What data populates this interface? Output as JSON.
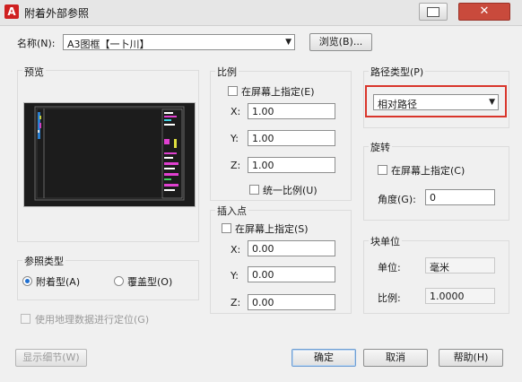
{
  "window": {
    "title": "附着外部参照",
    "close_glyph": "✕"
  },
  "name_row": {
    "label": "名称(N):",
    "value": "A3图框【一卜川】",
    "browse_label": "浏览(B)..."
  },
  "preview": {
    "title": "预览"
  },
  "scale": {
    "title": "比例",
    "onscreen_label": "在屏幕上指定(E)",
    "x_label": "X:",
    "x_value": "1.00",
    "y_label": "Y:",
    "y_value": "1.00",
    "z_label": "Z:",
    "z_value": "1.00",
    "uniform_label": "统一比例(U)"
  },
  "insertion": {
    "title": "插入点",
    "onscreen_label": "在屏幕上指定(S)",
    "x_label": "X:",
    "x_value": "0.00",
    "y_label": "Y:",
    "y_value": "0.00",
    "z_label": "Z:",
    "z_value": "0.00"
  },
  "path_type": {
    "title": "路径类型(P)",
    "value": "相对路径"
  },
  "rotation": {
    "title": "旋转",
    "onscreen_label": "在屏幕上指定(C)",
    "angle_label": "角度(G):",
    "angle_value": "0"
  },
  "block_unit": {
    "title": "块单位",
    "unit_label": "单位:",
    "unit_value": "毫米",
    "factor_label": "比例:",
    "factor_value": "1.0000"
  },
  "reference_type": {
    "title": "参照类型",
    "attach_label": "附着型(A)",
    "overlay_label": "覆盖型(O)",
    "selected": "attach"
  },
  "geo_label": "使用地理数据进行定位(G)",
  "buttons": {
    "details": "显示细节(W)",
    "ok": "确定",
    "cancel": "取消",
    "help": "帮助(H)"
  }
}
